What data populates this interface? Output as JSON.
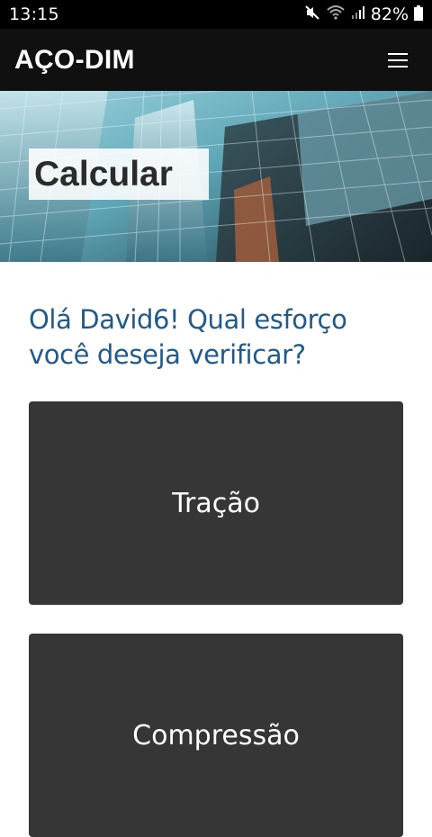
{
  "status_bar": {
    "time": "13:15",
    "battery_percent": "82%",
    "icons": [
      "mute-icon",
      "wifi-icon",
      "signal-icon",
      "battery-icon"
    ]
  },
  "header": {
    "title": "AÇO-DIM",
    "menu_icon": "hamburger-menu-icon"
  },
  "hero": {
    "title": "Calcular",
    "image": "glass-skyscraper-photo"
  },
  "main": {
    "question": "Olá David6! Qual esforço você deseja verificar?",
    "options": [
      {
        "label": "Tração"
      },
      {
        "label": "Compressão"
      }
    ]
  },
  "colors": {
    "status_bar_bg": "#000000",
    "header_bg": "#101010",
    "question_text": "#1f5a8a",
    "button_bg": "#363636",
    "button_text": "#ffffff"
  }
}
